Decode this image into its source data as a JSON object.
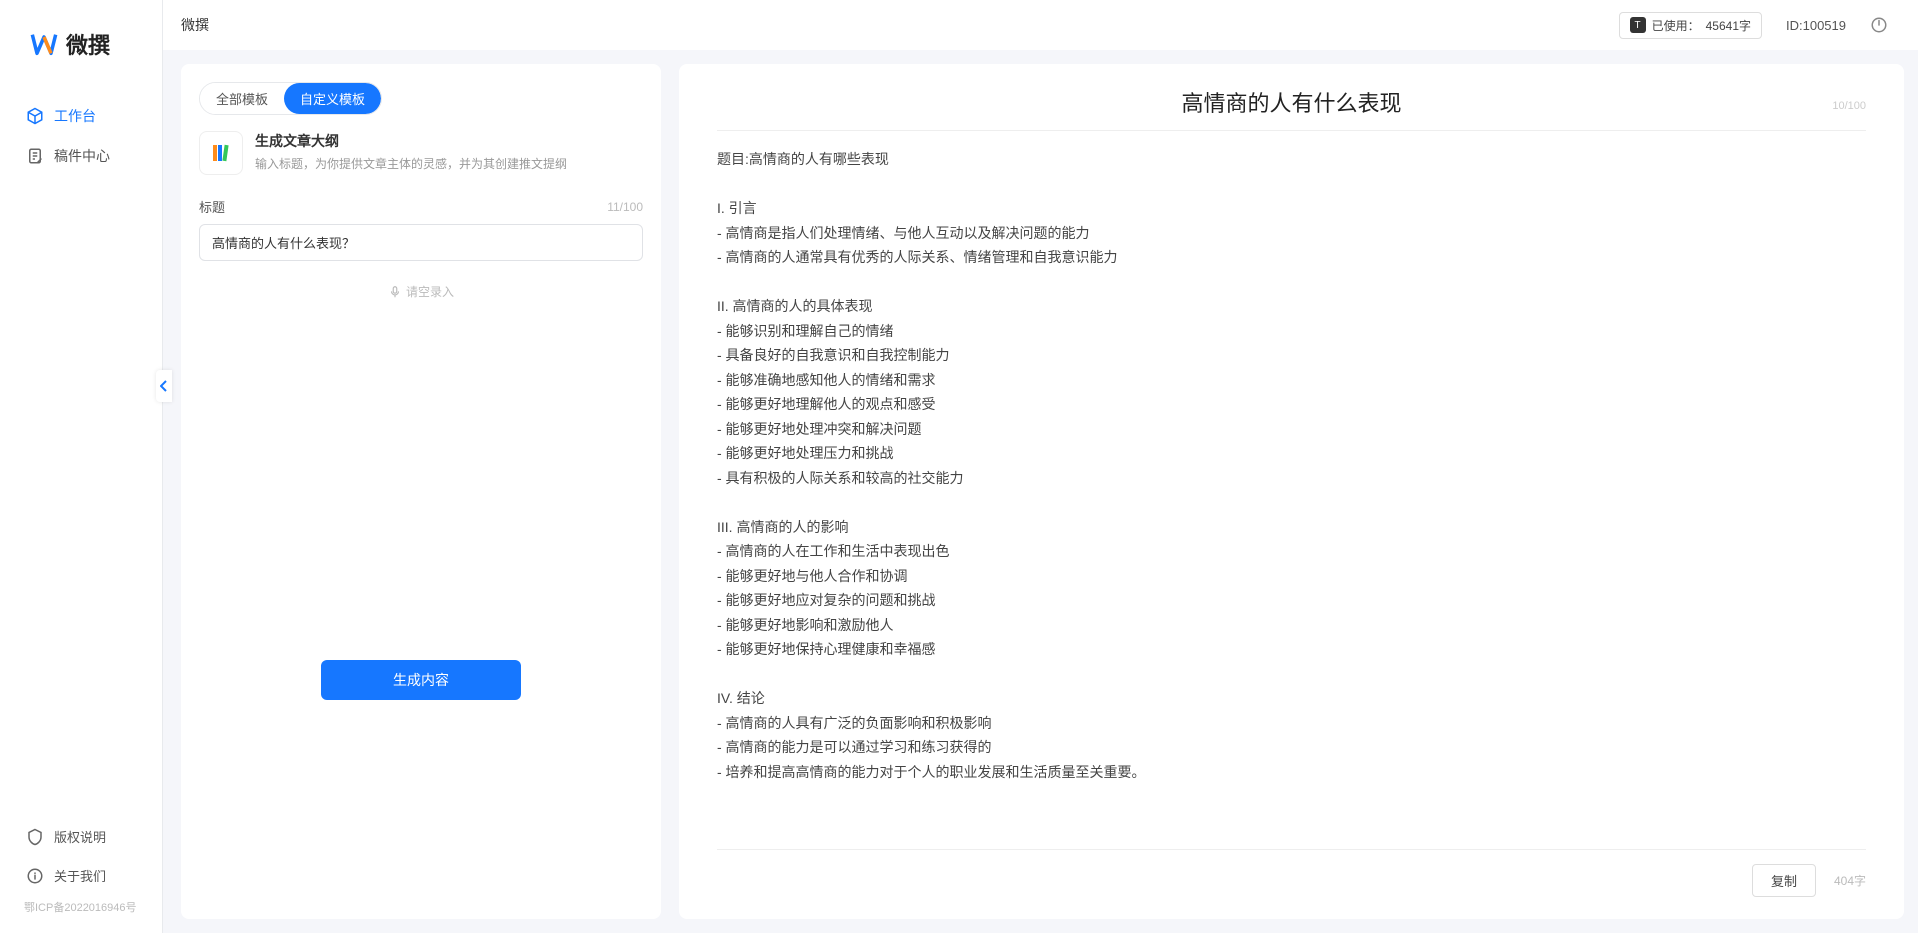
{
  "app": {
    "name": "微撰"
  },
  "topbar": {
    "title": "微撰",
    "usage_prefix": "已使用：",
    "usage_value": "45641字",
    "id_label": "ID:100519"
  },
  "sidebar": {
    "items": [
      {
        "label": "工作台",
        "icon": "cube",
        "active": true
      },
      {
        "label": "稿件中心",
        "icon": "doc",
        "active": false
      }
    ],
    "bottom": [
      {
        "label": "版权说明",
        "icon": "shield"
      },
      {
        "label": "关于我们",
        "icon": "info"
      }
    ],
    "icp": "鄂ICP备2022016946号"
  },
  "left_panel": {
    "tabs": {
      "all": "全部模板",
      "custom": "自定义模板"
    },
    "card": {
      "title": "生成文章大纲",
      "desc": "输入标题，为你提供文章主体的灵感，并为其创建推文提纲"
    },
    "field_label": "标题",
    "field_counter": "11/100",
    "input_value": "高情商的人有什么表现？",
    "input_placeholder": "",
    "voice_hint": "请空录入",
    "generate_label": "生成内容"
  },
  "right_panel": {
    "title": "高情商的人有什么表现",
    "title_counter": "10/100",
    "body": "题目:高情商的人有哪些表现\n\nI. 引言\n- 高情商是指人们处理情绪、与他人互动以及解决问题的能力\n- 高情商的人通常具有优秀的人际关系、情绪管理和自我意识能力\n\nII. 高情商的人的具体表现\n- 能够识别和理解自己的情绪\n- 具备良好的自我意识和自我控制能力\n- 能够准确地感知他人的情绪和需求\n- 能够更好地理解他人的观点和感受\n- 能够更好地处理冲突和解决问题\n- 能够更好地处理压力和挑战\n- 具有积极的人际关系和较高的社交能力\n\nIII. 高情商的人的影响\n- 高情商的人在工作和生活中表现出色\n- 能够更好地与他人合作和协调\n- 能够更好地应对复杂的问题和挑战\n- 能够更好地影响和激励他人\n- 能够更好地保持心理健康和幸福感\n\nIV. 结论\n- 高情商的人具有广泛的负面影响和积极影响\n- 高情商的能力是可以通过学习和练习获得的\n- 培养和提高高情商的能力对于个人的职业发展和生活质量至关重要。",
    "copy_label": "复制",
    "word_count": "404字"
  }
}
